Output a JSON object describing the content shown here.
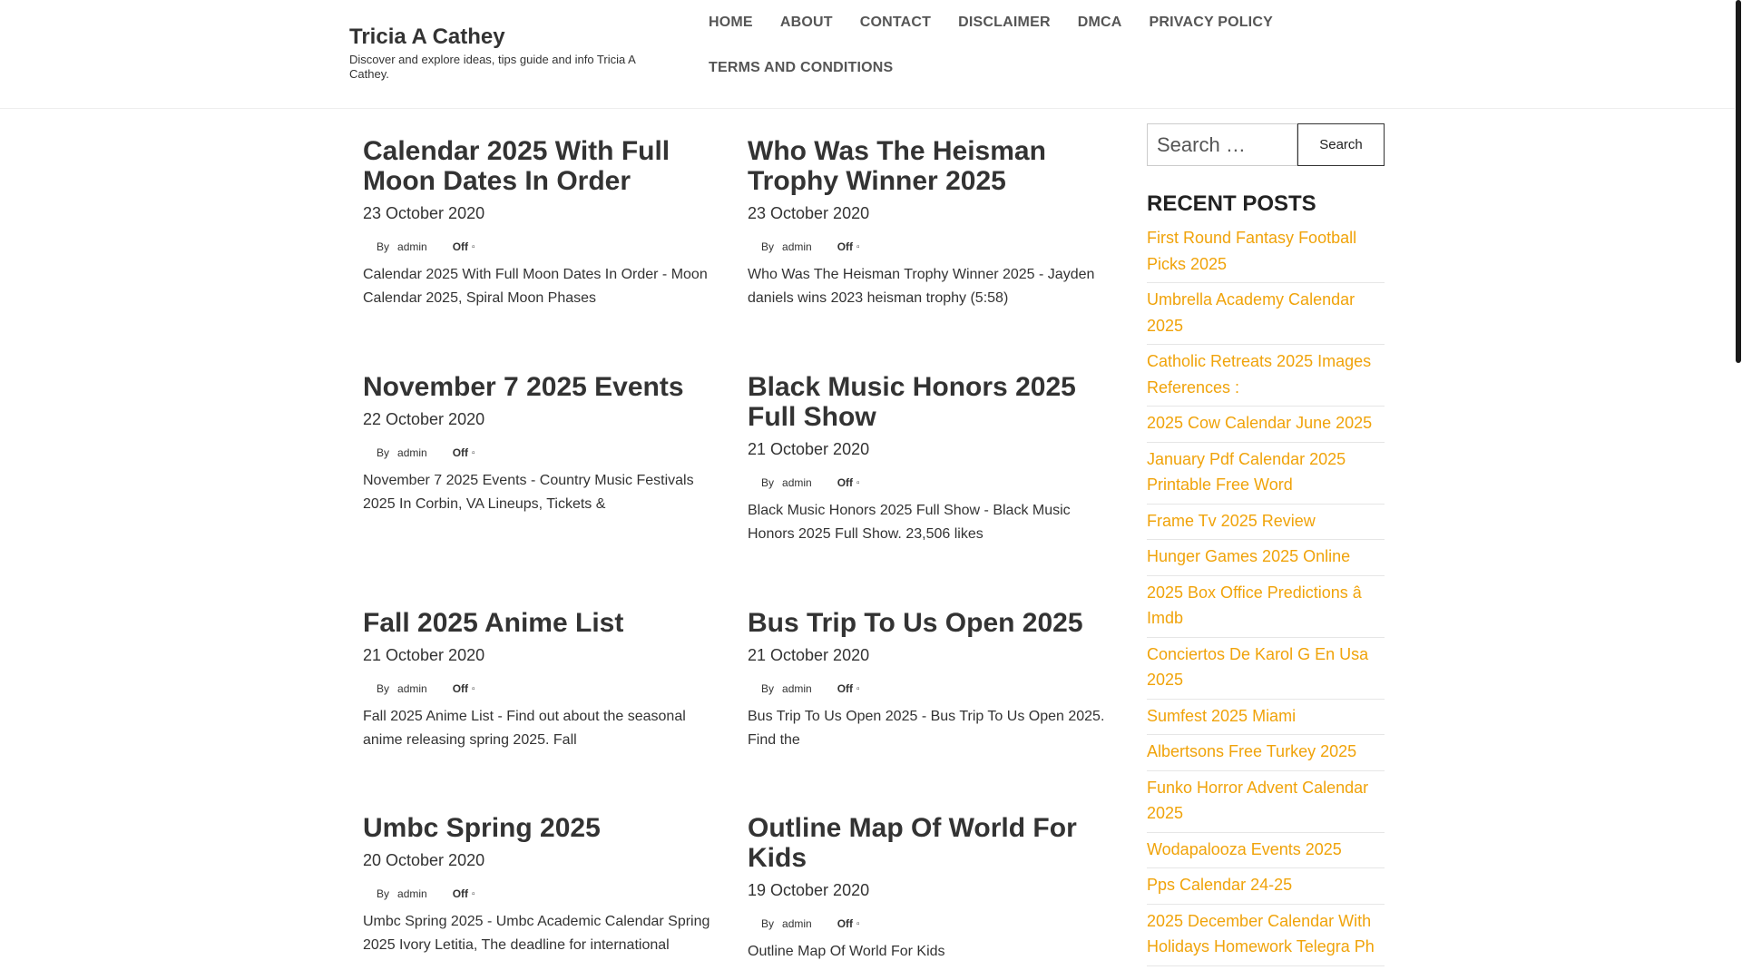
{
  "site": {
    "title": "Tricia A Cathey",
    "description": "Discover and explore ideas, tips guide and info Tricia A Cathey."
  },
  "nav": {
    "items": [
      "HOME",
      "ABOUT",
      "CONTACT",
      "DISCLAIMER",
      "DMCA",
      "PRIVACY POLICY",
      "TERMS AND CONDITIONS"
    ]
  },
  "posts": [
    {
      "title": "Calendar 2025 With Full Moon Dates In Order",
      "date": "23 October 2020",
      "by": "By",
      "author": "admin",
      "comments": "Off",
      "excerpt": "Calendar 2025 With Full Moon Dates In Order - Moon Calendar 2025, Spiral Moon Phases"
    },
    {
      "title": "Who Was The Heisman Trophy Winner 2025",
      "date": "23 October 2020",
      "by": "By",
      "author": "admin",
      "comments": "Off",
      "excerpt": "Who Was The Heisman Trophy Winner 2025 - Jayden daniels wins 2023 heisman trophy (5:58)"
    },
    {
      "title": "November 7 2025 Events",
      "date": "22 October 2020",
      "by": "By",
      "author": "admin",
      "comments": "Off",
      "excerpt": "November 7 2025 Events - Country Music Festivals 2025 In Corbin, VA Lineups, Tickets &"
    },
    {
      "title": "Black Music Honors 2025 Full Show",
      "date": "21 October 2020",
      "by": "By",
      "author": "admin",
      "comments": "Off",
      "excerpt": "Black Music Honors 2025 Full Show - Black Music Honors 2025 Full Show. 23,506 likes"
    },
    {
      "title": "Fall 2025 Anime List",
      "date": "21 October 2020",
      "by": "By",
      "author": "admin",
      "comments": "Off",
      "excerpt": "Fall 2025 Anime List - Find out about the seasonal anime releasing spring 2025. Fall"
    },
    {
      "title": "Bus Trip To Us Open 2025",
      "date": "21 October 2020",
      "by": "By",
      "author": "admin",
      "comments": "Off",
      "excerpt": "Bus Trip To Us Open 2025 - Bus Trip To Us Open 2025. Find the"
    },
    {
      "title": "Umbc Spring 2025",
      "date": "20 October 2020",
      "by": "By",
      "author": "admin",
      "comments": "Off",
      "excerpt": "Umbc Spring 2025 - Umbc Academic Calendar Spring 2025 Ivory Letitia, The deadline for international"
    },
    {
      "title": "Outline Map Of World For Kids",
      "date": "19 October 2020",
      "by": "By",
      "author": "admin",
      "comments": "Off",
      "excerpt": "Outline Map Of World For Kids"
    }
  ],
  "sidebar": {
    "search_placeholder": "Search …",
    "search_button": "Search",
    "recent_title": "RECENT POSTS",
    "recent_posts": [
      "First Round Fantasy Football Picks 2025",
      "Umbrella Academy Calendar 2025",
      "Catholic Retreats 2025 Images References :",
      "2025 Cow Calendar June 2025",
      "January Pdf Calendar 2025 Printable Free Word",
      "Frame Tv 2025 Review",
      "Hunger Games 2025 Online",
      "2025 Box Office Predictions â Imdb",
      "Conciertos De Karol G En Usa 2025",
      "Sumfest 2025 Miami",
      "Albertsons Free Turkey 2025",
      "Funko Horror Advent Calendar 2025",
      "Wodapalooza Events 2025",
      "Pps Calendar 24-25",
      "2025 December Calendar With Holidays Homework Telegra Ph"
    ]
  },
  "colors": {
    "link_accent": "#f0a30a",
    "text": "#333333"
  }
}
